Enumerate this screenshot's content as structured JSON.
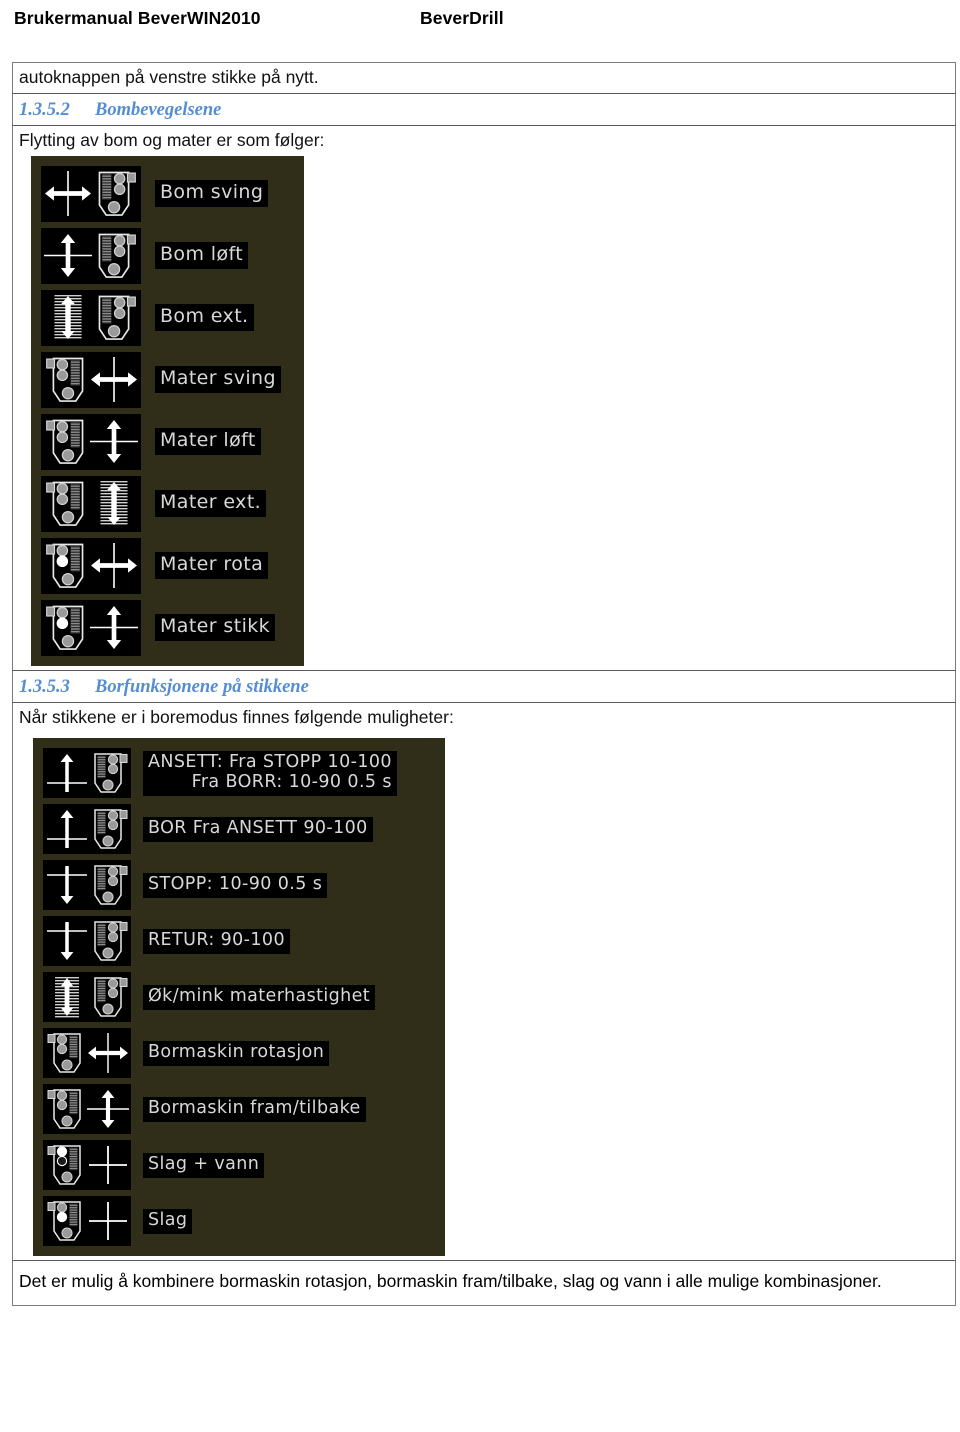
{
  "header": {
    "left": "Brukermanual BeverWIN2010",
    "right": "BeverDrill"
  },
  "intro": {
    "continued_text": "autoknappen på venstre stikke på nytt."
  },
  "section_bom": {
    "number": "1.3.5.2",
    "title": "Bombevegelsene",
    "lead_text": "Flytting av bom og mater er som følger:",
    "panel": {
      "background_color": "#302e18",
      "chip_background": "#000000",
      "chip_text_color": "#d8d8d8",
      "rows": [
        {
          "label": "Bom sving",
          "arrow": "double-horizontal",
          "joystick_side": "right",
          "highlight": "none"
        },
        {
          "label": "Bom løft",
          "arrow": "double-vertical",
          "joystick_side": "right",
          "highlight": "none"
        },
        {
          "label": "Bom ext.",
          "arrow": "extend-vertical",
          "joystick_side": "right",
          "highlight": "none"
        },
        {
          "label": "Mater sving",
          "arrow": "double-horizontal",
          "joystick_side": "left",
          "highlight": "none"
        },
        {
          "label": "Mater løft",
          "arrow": "double-vertical",
          "joystick_side": "left",
          "highlight": "none"
        },
        {
          "label": "Mater ext.",
          "arrow": "extend-vertical",
          "joystick_side": "left",
          "highlight": "none"
        },
        {
          "label": "Mater rota",
          "arrow": "double-horizontal",
          "joystick_side": "left",
          "highlight": "middle"
        },
        {
          "label": "Mater stikk",
          "arrow": "double-vertical",
          "joystick_side": "left",
          "highlight": "middle"
        }
      ]
    }
  },
  "section_bor": {
    "number": "1.3.5.3",
    "title": "Borfunksjonene på stikkene",
    "lead_text": "Når stikkene er i boremodus finnes følgende muligheter:",
    "panel": {
      "rows": [
        {
          "label_line1": "ANSETT: Fra STOPP 10-100",
          "label_line2": "Fra BORR: 10-90 0.5 s",
          "arrow": "up-single",
          "joystick_side": "right",
          "highlight": "none"
        },
        {
          "label_line1": "BOR Fra ANSETT 90-100",
          "label_line2": "",
          "arrow": "up-single",
          "joystick_side": "right",
          "highlight": "none"
        },
        {
          "label_line1": "STOPP: 10-90 0.5 s",
          "label_line2": "",
          "arrow": "down-single",
          "joystick_side": "right",
          "highlight": "none"
        },
        {
          "label_line1": "RETUR: 90-100",
          "label_line2": "",
          "arrow": "down-single",
          "joystick_side": "right",
          "highlight": "none"
        },
        {
          "label_line1": "Øk/mink materhastighet",
          "label_line2": "",
          "arrow": "extend-vertical",
          "joystick_side": "right",
          "highlight": "none"
        },
        {
          "label_line1": "Bormaskin rotasjon",
          "label_line2": "",
          "arrow": "double-horizontal",
          "joystick_side": "left",
          "highlight": "none"
        },
        {
          "label_line1": "Bormaskin fram/tilbake",
          "label_line2": "",
          "arrow": "double-vertical",
          "joystick_side": "left",
          "highlight": "none"
        },
        {
          "label_line1": "Slag + vann",
          "label_line2": "",
          "arrow": "cross-plain",
          "joystick_side": "left",
          "highlight": "top-two"
        },
        {
          "label_line1": "Slag",
          "label_line2": "",
          "arrow": "cross-plain",
          "joystick_side": "left",
          "highlight": "middle"
        }
      ]
    }
  },
  "footer": {
    "note": "Det er mulig å kombinere bormaskin rotasjon, bormaskin fram/tilbake, slag og vann i alle mulige kombinasjoner."
  },
  "colors": {
    "heading": "#548dd4",
    "panel_bg": "#302e18",
    "table_border": "#7b7b7b"
  }
}
